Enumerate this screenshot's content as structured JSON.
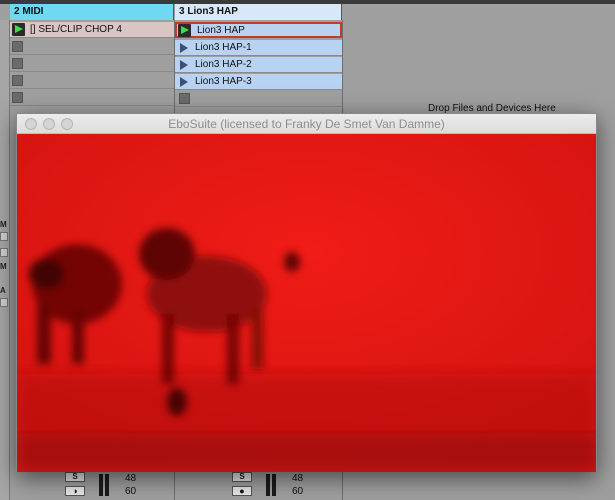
{
  "tracks": {
    "midi": {
      "name": "2 MIDI",
      "color": "#6fd9f4"
    },
    "lion": {
      "name": "3 Lion3 HAP",
      "color": "#d8e8f8"
    }
  },
  "midi_clips": [
    {
      "label": "[] SEL/CLIP CHOP 4",
      "playing": true
    }
  ],
  "lion_clips": [
    {
      "label": "Lion3 HAP",
      "playing": true
    },
    {
      "label": "Lion3 HAP-1",
      "playing": false
    },
    {
      "label": "Lion3 HAP-2",
      "playing": false
    },
    {
      "label": "Lion3 HAP-3",
      "playing": false
    }
  ],
  "drop_area": {
    "label": "Drop Files and Devices Here"
  },
  "side_labels": {
    "m1": "M",
    "m2": "M",
    "a": "A"
  },
  "mixer": {
    "left": {
      "solo": "S",
      "value_top": "48",
      "value_bottom": "60"
    },
    "right": {
      "solo": "S",
      "value_top": "48",
      "value_bottom": "60"
    }
  },
  "ebo_window": {
    "title": "EboSuite (licensed to Franky De Smet Van Damme)",
    "video_description_icon": "video-frame",
    "background_color": "#d81412"
  }
}
